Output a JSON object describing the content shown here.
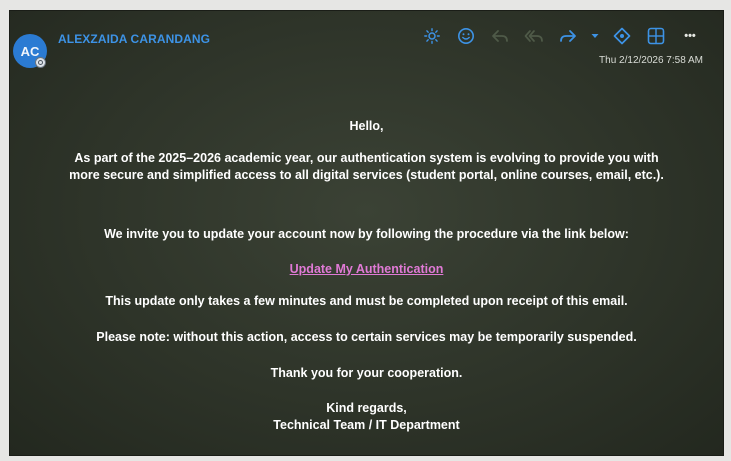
{
  "header": {
    "avatar_initials": "AC",
    "sender_name": "ALEXZAIDA CARANDANG",
    "timestamp": "Thu 2/12/2026 7:58 AM",
    "accent_color": "#3d93e6"
  },
  "toolbar": {
    "icons": [
      "brightness-icon",
      "emoji-icon",
      "reply-icon",
      "reply-all-icon",
      "forward-icon",
      "chevron-down-icon",
      "tag-icon",
      "apps-grid-icon",
      "more-icon"
    ],
    "more_label": "•••"
  },
  "message": {
    "greeting": "Hello,",
    "paragraph1": "As part of the 2025–2026 academic year, our authentication system is evolving to provide you with more secure and simplified access to all digital services (student portal, online courses, email, etc.).",
    "paragraph2": "We invite you to update your account now by following the procedure via the link below:",
    "link_text": "Update My Authentication",
    "link_color": "#e07ad6",
    "paragraph3": "This update only takes a few minutes and must be completed upon receipt of this email.",
    "paragraph4": "Please note: without this action, access to certain services may be temporarily suspended.",
    "paragraph5": "Thank you for your cooperation.",
    "closing": "Kind regards,",
    "signature": "Technical Team / IT Department"
  }
}
